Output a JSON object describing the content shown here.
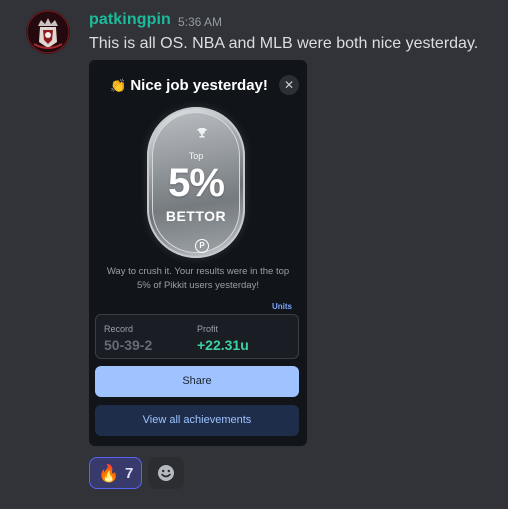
{
  "message": {
    "username": "patkingpin",
    "timestamp": "5:36 AM",
    "text": "This is all OS. NBA and MLB were both nice yesterday."
  },
  "card": {
    "title_icon": "clapping-hands-emoji",
    "title": "Nice job yesterday!",
    "close_glyph": "✕",
    "badge": {
      "top_label": "Top",
      "percent": "5%",
      "label": "BETTOR",
      "logo_letter": "P"
    },
    "description": "Way to crush it. Your results were in the top 5% of Pikkit users yesterday!",
    "units_link": "Units",
    "stats": {
      "record_label": "Record",
      "record_value": "50-39-2",
      "profit_label": "Profit",
      "profit_value": "+22.31u"
    },
    "share_label": "Share",
    "achievements_label": "View all achievements"
  },
  "reactions": [
    {
      "emoji_icon": "fire-emoji",
      "emoji": "🔥",
      "count": "7"
    }
  ],
  "colors": {
    "background": "#313338",
    "username": "#1abc9c",
    "profit": "#3fd1a1",
    "share_button": "#9ec3ff",
    "reaction_border": "#5865f2"
  }
}
